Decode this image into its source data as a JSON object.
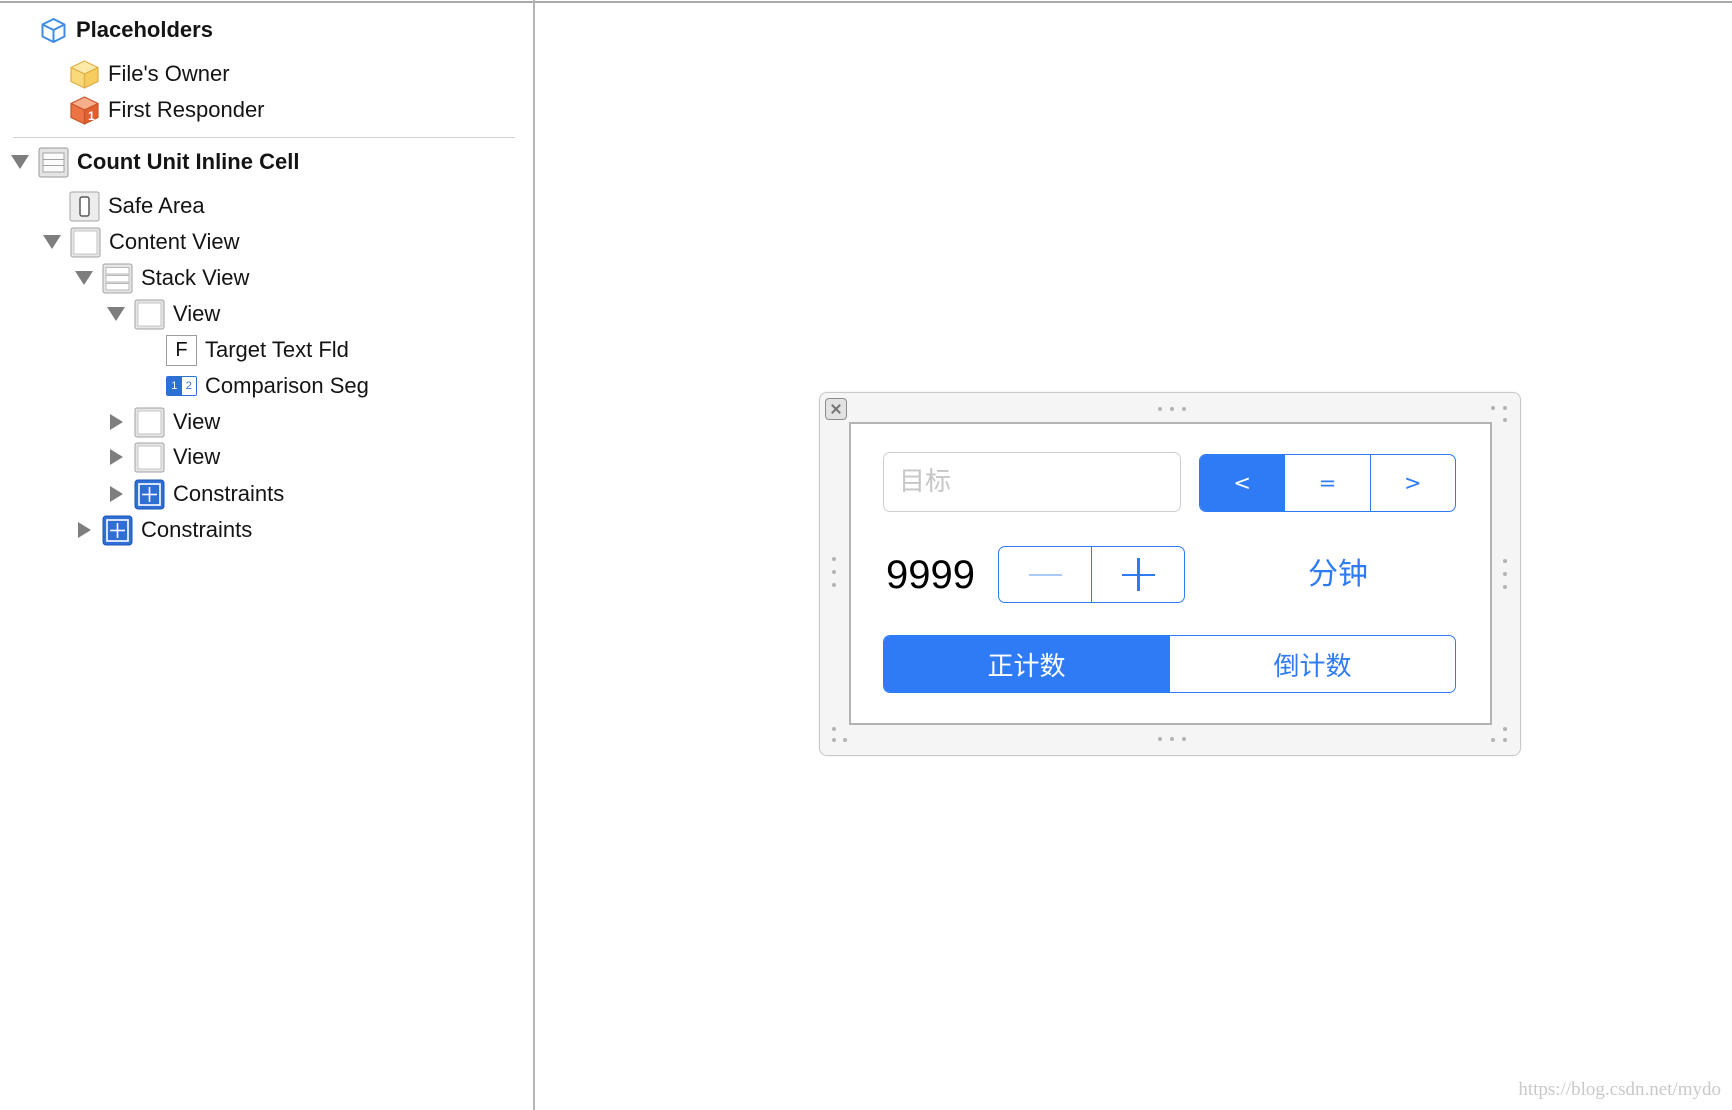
{
  "colors": {
    "accent": "#2f7bf5",
    "stepper_decrement_tint": "#a9c9f8"
  },
  "outline": {
    "items": [
      {
        "label": "Placeholders",
        "icon": "placeholders-cube-icon"
      },
      {
        "label": "File's Owner",
        "icon": "files-owner-cube-icon"
      },
      {
        "label": "First Responder",
        "icon": "first-responder-cube-icon",
        "glyph": "1"
      },
      {
        "label": "Count Unit Inline Cell",
        "icon": "table-view-cell-icon",
        "disclosure": "expanded"
      },
      {
        "label": "Safe Area",
        "icon": "safe-area-icon"
      },
      {
        "label": "Content View",
        "icon": "view-icon",
        "disclosure": "expanded"
      },
      {
        "label": "Stack View",
        "icon": "stack-view-icon",
        "disclosure": "expanded"
      },
      {
        "label": "View",
        "icon": "view-icon",
        "disclosure": "expanded"
      },
      {
        "label": "Target Text Fld",
        "icon": "text-field-icon",
        "glyph": "F"
      },
      {
        "label": "Comparison Seg",
        "icon": "segmented-control-icon",
        "glyphs": [
          "1",
          "2"
        ]
      },
      {
        "label": "View",
        "icon": "view-icon",
        "disclosure": "collapsed"
      },
      {
        "label": "View",
        "icon": "view-icon",
        "disclosure": "collapsed"
      },
      {
        "label": "Constraints",
        "icon": "constraints-icon",
        "disclosure": "collapsed"
      },
      {
        "label": "Constraints",
        "icon": "constraints-icon",
        "disclosure": "collapsed"
      }
    ]
  },
  "canvas": {
    "target_field": {
      "placeholder": "目标"
    },
    "comparison_control": {
      "segments": [
        {
          "label": "<",
          "selected": true
        },
        {
          "label": "=",
          "selected": false
        },
        {
          "label": ">",
          "selected": false
        }
      ]
    },
    "count_label": "9999",
    "stepper": {
      "decrement_icon": "minus-icon",
      "increment_icon": "plus-icon"
    },
    "unit_label": "分钟",
    "mode_control": {
      "segments": [
        {
          "label": "正计数",
          "selected": true
        },
        {
          "label": "倒计数",
          "selected": false
        }
      ]
    }
  },
  "watermark": "https://blog.csdn.net/mydo"
}
